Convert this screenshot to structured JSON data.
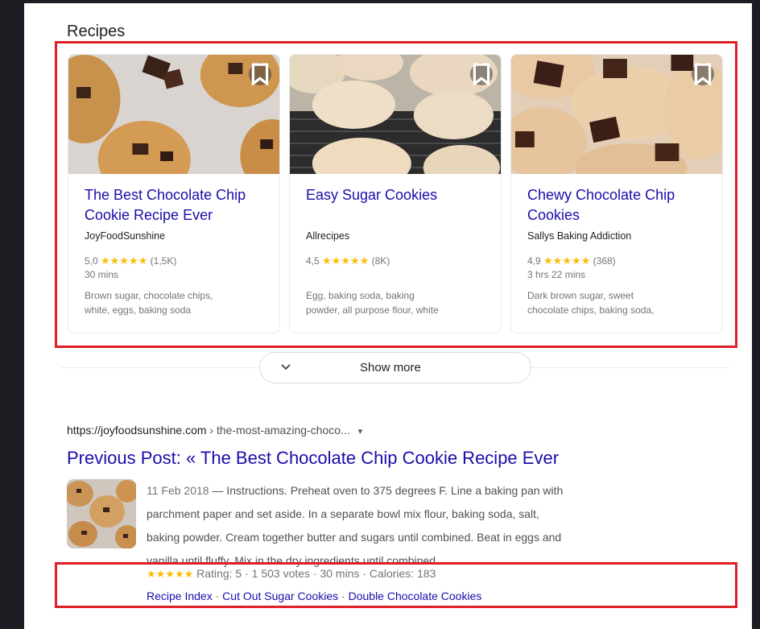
{
  "section_title": "Recipes",
  "cards": [
    {
      "title_line1": "The Best Chocolate Chip",
      "title_line2": "Cookie Recipe Ever",
      "source": "JoyFoodSunshine",
      "rating": "5,0",
      "stars": "★★★★★",
      "votes": "(1,5K)",
      "time": "30 mins",
      "ingredients_line1": "Brown sugar, chocolate chips,",
      "ingredients_line2": "white, eggs, baking soda"
    },
    {
      "title_line1": "Easy Sugar Cookies",
      "title_line2": "",
      "source": "Allrecipes",
      "rating": "4,5",
      "stars": "★★★★★",
      "votes": "(8K)",
      "time": "",
      "ingredients_line1": "Egg, baking soda, baking",
      "ingredients_line2": "powder, all purpose flour, white"
    },
    {
      "title_line1": "Chewy Chocolate Chip",
      "title_line2": "Cookies",
      "source": "Sallys Baking Addiction",
      "rating": "4,9",
      "stars": "★★★★★",
      "votes": "(368)",
      "time": "3 hrs 22 mins",
      "ingredients_line1": "Dark brown sugar, sweet",
      "ingredients_line2": "chocolate chips, baking soda,"
    }
  ],
  "show_more": "Show more",
  "result": {
    "url_domain": "https://joyfoodsunshine.com",
    "url_path": " › the-most-amazing-choco...",
    "url_menu": "▾",
    "title": "Previous Post: « The Best Chocolate Chip Cookie Recipe Ever",
    "date": "11 Feb 2018",
    "snippet_line1": " — Instructions. Preheat oven to 375 degrees F. Line a baking pan with",
    "snippet_line2": "parchment paper and set aside. In a separate bowl mix flour, baking soda, salt,",
    "snippet_line3": "baking powder. Cream together butter and sugars until combined. Beat in eggs and",
    "snippet_line4": "vanilla until fluffy. Mix in the dry ingredients until combined.",
    "stars": "★★★★★",
    "rich_text": " Rating: 5 · 1 503 votes · 30 mins · Calories: 183",
    "sitelinks": [
      "Recipe Index",
      "Cut Out Sugar Cookies",
      "Double Chocolate Cookies"
    ],
    "sitelink_separator": " · "
  },
  "colors": {
    "link": "#1a0dab",
    "star": "#fbbc04",
    "highlight_box": "#dd1f26",
    "muted_text": "#70757a"
  },
  "icons": [
    "bookmark-icon",
    "chevron-down-icon",
    "dropdown-arrow-icon",
    "star-icon"
  ]
}
